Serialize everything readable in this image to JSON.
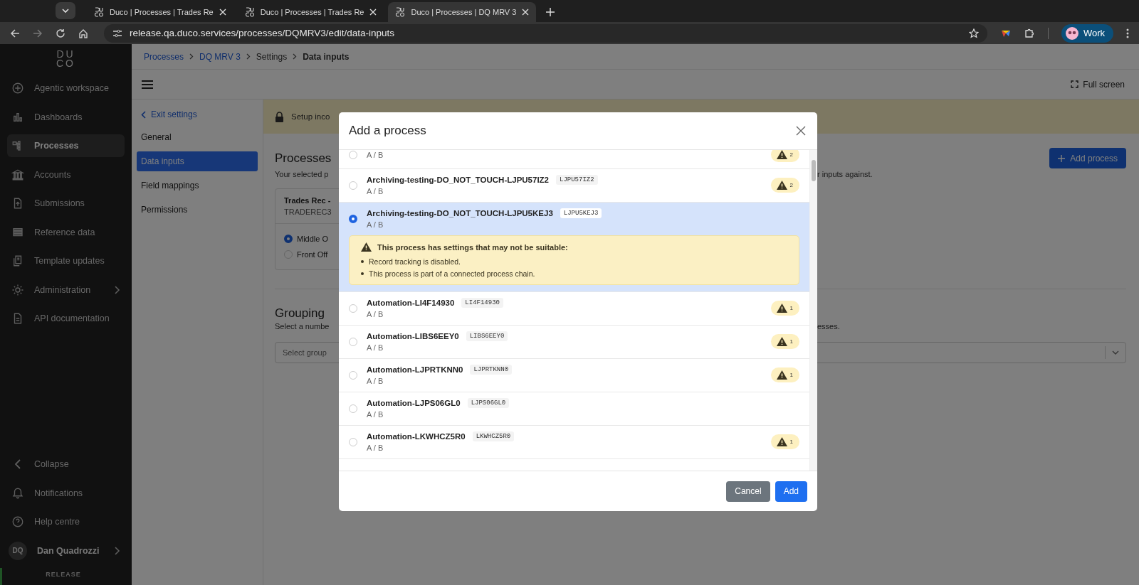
{
  "browser": {
    "tabs": [
      {
        "title": "Duco | Processes | Trades Re",
        "selected": false
      },
      {
        "title": "Duco | Processes | Trades Re",
        "selected": false
      },
      {
        "title": "Duco | Processes | DQ MRV 3",
        "selected": true
      }
    ],
    "url": "release.qa.duco.services/processes/DQMRV3/edit/data-inputs",
    "profile": "Work"
  },
  "sidebar": {
    "logo": [
      "DU",
      "CO"
    ],
    "items": [
      {
        "label": "Agentic workspace",
        "selected": false,
        "submenu": false
      },
      {
        "label": "Dashboards",
        "selected": false,
        "submenu": false
      },
      {
        "label": "Processes",
        "selected": true,
        "submenu": false
      },
      {
        "label": "Accounts",
        "selected": false,
        "submenu": false
      },
      {
        "label": "Submissions",
        "selected": false,
        "submenu": false
      },
      {
        "label": "Reference data",
        "selected": false,
        "submenu": false
      },
      {
        "label": "Template updates",
        "selected": false,
        "submenu": false
      },
      {
        "label": "Administration",
        "selected": false,
        "submenu": true
      },
      {
        "label": "API documentation",
        "selected": false,
        "submenu": false
      }
    ],
    "footer_items": [
      "Collapse",
      "Notifications",
      "Help centre"
    ],
    "user": {
      "initials": "DQ",
      "name": "Dan Quadrozzi"
    },
    "environment": "RELEASE"
  },
  "breadcrumb": [
    "Processes",
    "DQ MRV 3",
    "Settings",
    "Data inputs"
  ],
  "toolbar": {
    "fullscreen": "Full screen"
  },
  "settings_nav": {
    "back": "Exit settings",
    "items": [
      {
        "label": "General",
        "selected": false
      },
      {
        "label": "Data inputs",
        "selected": true
      },
      {
        "label": "Field mappings",
        "selected": false
      },
      {
        "label": "Permissions",
        "selected": false
      }
    ]
  },
  "banner": {
    "text": "Setup inco"
  },
  "processes_section": {
    "title": "Processes",
    "description_start": "Your selected p",
    "description_end": "r inputs against.",
    "add_button": "Add process",
    "card": {
      "title": "Trades Rec -",
      "code": "TRADEREC3",
      "options": [
        {
          "label": "Middle O",
          "selected": true
        },
        {
          "label": "Front Off",
          "selected": false
        }
      ]
    }
  },
  "grouping_section": {
    "title": "Grouping",
    "description_start": "Select a numbe",
    "description_end": "esses.",
    "select": {
      "placeholder": "Select group"
    }
  },
  "modal": {
    "title": "Add a process",
    "rows": [
      {
        "sub": "A / B",
        "warnings": "2",
        "selected": false
      },
      {
        "name": "Archiving-testing-DO_NOT_TOUCH-LJPU57IZ2",
        "code": "LJPU57IZ2",
        "sub": "A / B",
        "warnings": "2",
        "selected": false
      },
      {
        "name": "Archiving-testing-DO_NOT_TOUCH-LJPU5KEJ3",
        "code": "LJPU5KEJ3",
        "sub": "A / B",
        "selected": true,
        "alert": {
          "title": "This process has settings that may not be suitable:",
          "items": [
            "Record tracking is disabled.",
            "This process is part of a connected process chain."
          ]
        }
      },
      {
        "name": "Automation-LI4F14930",
        "code": "LI4F14930",
        "sub": "A / B",
        "warnings": "1",
        "selected": false
      },
      {
        "name": "Automation-LIBS6EEY0",
        "code": "LIBS6EEY0",
        "sub": "A / B",
        "warnings": "1",
        "selected": false
      },
      {
        "name": "Automation-LJPRTKNN0",
        "code": "LJPRTKNN0",
        "sub": "A / B",
        "warnings": "1",
        "selected": false
      },
      {
        "name": "Automation-LJPS06GL0",
        "code": "LJPS06GL0",
        "sub": "A / B",
        "selected": false
      },
      {
        "name": "Automation-LKWHCZ5R0",
        "code": "LKWHCZ5R0",
        "sub": "A / B",
        "warnings": "1",
        "selected": false
      }
    ],
    "buttons": {
      "cancel": "Cancel",
      "confirm": "Add"
    }
  }
}
